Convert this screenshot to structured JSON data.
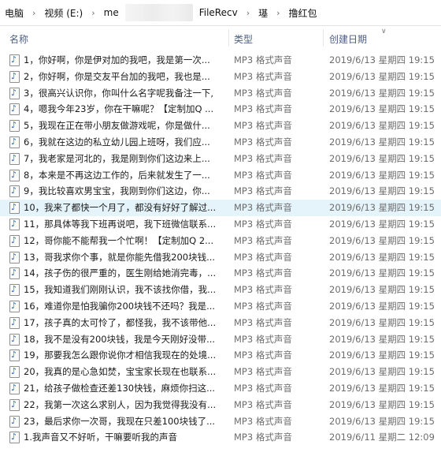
{
  "breadcrumb": {
    "items": [
      "电脑",
      "视频 (E:)",
      "me",
      "FileRecv",
      "璂",
      "撸红包"
    ]
  },
  "columns": {
    "name": "名称",
    "type": "类型",
    "date": "创建日期"
  },
  "files": [
    {
      "name": "1，你好啊，你是伊对加的我吧，我是第一次...",
      "type": "MP3 格式声音",
      "date": "2019/6/13 星期四 19:15"
    },
    {
      "name": "2，你好啊，你是交友平台加的我吧，我也是...",
      "type": "MP3 格式声音",
      "date": "2019/6/13 星期四 19:15"
    },
    {
      "name": "3，很高兴认识你，你叫什么名字呢我备注一下,",
      "type": "MP3 格式声音",
      "date": "2019/6/13 星期四 19:15"
    },
    {
      "name": "4，嗯我今年23岁，你在干嘛呢？【定制加Q ...",
      "type": "MP3 格式声音",
      "date": "2019/6/13 星期四 19:15"
    },
    {
      "name": "5，我现在正在带小朋友做游戏呢，你是做什...",
      "type": "MP3 格式声音",
      "date": "2019/6/13 星期四 19:15"
    },
    {
      "name": "6，我就在这边的私立幼儿园上班呀，我们应...",
      "type": "MP3 格式声音",
      "date": "2019/6/13 星期四 19:15"
    },
    {
      "name": "7，我老家是河北的，我是刚到你们这边来上...",
      "type": "MP3 格式声音",
      "date": "2019/6/13 星期四 19:15"
    },
    {
      "name": "8，本来是不再这边工作的，后来就发生了一...",
      "type": "MP3 格式声音",
      "date": "2019/6/13 星期四 19:15"
    },
    {
      "name": "9，我比较喜欢男宝宝，我刚到你们这边，你...",
      "type": "MP3 格式声音",
      "date": "2019/6/13 星期四 19:15"
    },
    {
      "name": "10，我来了都快一个月了，都没有好好了解过...",
      "type": "MP3 格式声音",
      "date": "2019/6/13 星期四 19:15"
    },
    {
      "name": "11，那具体等我下班再说吧，我下班微信联系...",
      "type": "MP3 格式声音",
      "date": "2019/6/13 星期四 19:15"
    },
    {
      "name": "12，哥你能不能帮我一个忙啊！【定制加Q 2...",
      "type": "MP3 格式声音",
      "date": "2019/6/13 星期四 19:15"
    },
    {
      "name": "13，哥我求你个事，就是你能先借我200块钱...",
      "type": "MP3 格式声音",
      "date": "2019/6/13 星期四 19:15"
    },
    {
      "name": "14，孩子伤的很严重的，医生刚给她消完毒，...",
      "type": "MP3 格式声音",
      "date": "2019/6/13 星期四 19:15"
    },
    {
      "name": "15，我知道我们刚刚认识，我不该找你借，我...",
      "type": "MP3 格式声音",
      "date": "2019/6/13 星期四 19:15"
    },
    {
      "name": "16，难道你是怕我骗你200块钱不还吗？我是...",
      "type": "MP3 格式声音",
      "date": "2019/6/13 星期四 19:15"
    },
    {
      "name": "17，孩子真的太可怜了，都怪我，我不该带他...",
      "type": "MP3 格式声音",
      "date": "2019/6/13 星期四 19:15"
    },
    {
      "name": "18，我不是没有200块钱，我是今天刚好没带...",
      "type": "MP3 格式声音",
      "date": "2019/6/13 星期四 19:15"
    },
    {
      "name": "19，那要我怎么跟你说你才相信我现在的处境...",
      "type": "MP3 格式声音",
      "date": "2019/6/13 星期四 19:15"
    },
    {
      "name": "20，我真的是心急如焚，宝宝家长现在也联系...",
      "type": "MP3 格式声音",
      "date": "2019/6/13 星期四 19:15"
    },
    {
      "name": "21，给孩子做检查还差130快钱，麻烦你扫这...",
      "type": "MP3 格式声音",
      "date": "2019/6/13 星期四 19:15"
    },
    {
      "name": "22，我第一次这么求别人，因为我觉得我没有...",
      "type": "MP3 格式声音",
      "date": "2019/6/13 星期四 19:15"
    },
    {
      "name": "23，最后求你一次哥，我现在只差100块钱了...",
      "type": "MP3 格式声音",
      "date": "2019/6/13 星期四 19:15"
    },
    {
      "name": "1.我声音又不好听，干嘛要听我的声音",
      "type": "MP3 格式声音",
      "date": "2019/6/11 星期二 12:09"
    }
  ],
  "selected_index": 9,
  "colors": {
    "selected_row": "#e5f3fb",
    "header_text": "#4d6082",
    "secondary_text": "#6d6d6d"
  }
}
